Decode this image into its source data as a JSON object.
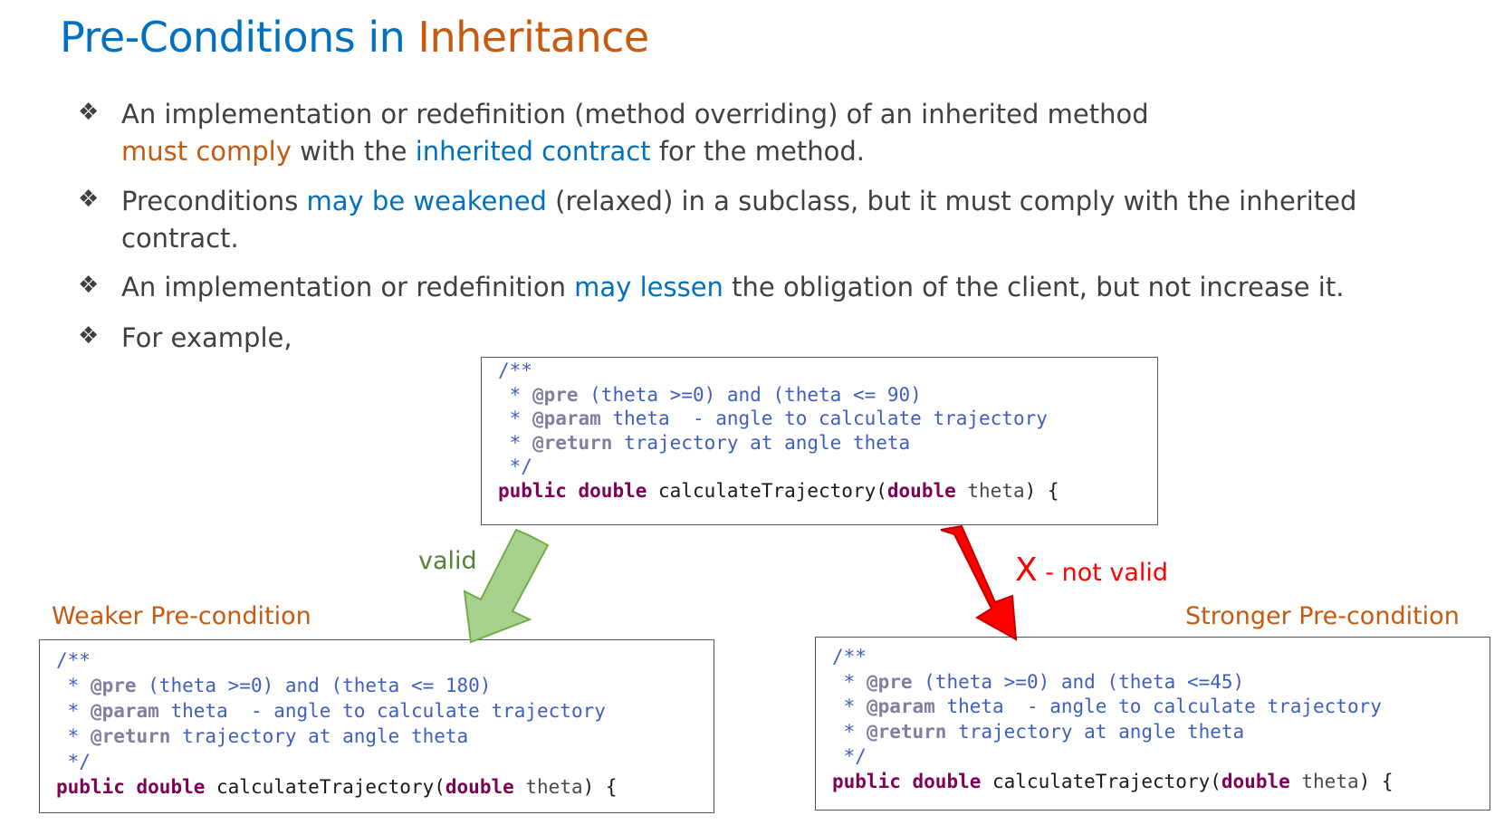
{
  "title": {
    "part1": "Pre-Conditions in ",
    "part2": "Inheritance"
  },
  "bullets": [
    {
      "mark": "❖",
      "segments": [
        {
          "text": "An implementation or redefinition (method overriding) of an inherited method",
          "color": "default"
        },
        {
          "text": "must comply",
          "color": "orange"
        },
        {
          "text": " with the ",
          "color": "default"
        },
        {
          "text": "inherited contract",
          "color": "blue"
        },
        {
          "text": " for the method.",
          "color": "default"
        }
      ]
    },
    {
      "mark": "❖",
      "segments": [
        {
          "text": "Preconditions ",
          "color": "default"
        },
        {
          "text": "may be weakened",
          "color": "blue"
        },
        {
          "text": " (relaxed) in a subclass, but it must comply with the inherited contract.",
          "color": "default"
        }
      ]
    },
    {
      "mark": "❖",
      "segments": [
        {
          "text": "An implementation or redefinition ",
          "color": "default"
        },
        {
          "text": "may lessen",
          "color": "blue"
        },
        {
          "text": " the obligation of the client, but not increase it.",
          "color": "default"
        }
      ]
    },
    {
      "mark": "❖",
      "segments": [
        {
          "text": "For example,",
          "color": "default"
        }
      ]
    }
  ],
  "code": {
    "base": {
      "open": "/**",
      "pre_tag": "@pre",
      "pre_text": " (theta >=0) and (theta <= 90)",
      "param_tag": "@param",
      "param_text": " theta  - angle to calculate trajectory",
      "return_tag": "@return",
      "return_text": " trajectory at angle theta",
      "close": " */",
      "kw_public": "public",
      "kw_double": "double",
      "method": " calculateTrajectory(",
      "kw_double2": "double",
      "arg": " theta",
      "end": ") {"
    },
    "weaker": {
      "open": "/**",
      "pre_tag": "@pre",
      "pre_text": " (theta >=0) and (theta <= 180)",
      "param_tag": "@param",
      "param_text": " theta  - angle to calculate trajectory",
      "return_tag": "@return",
      "return_text": " trajectory at angle theta",
      "close": " */",
      "kw_public": "public",
      "kw_double": "double",
      "method": " calculateTrajectory(",
      "kw_double2": "double",
      "arg": " theta",
      "end": ") {"
    },
    "stronger": {
      "open": "/**",
      "pre_tag": "@pre",
      "pre_text": " (theta >=0) and (theta <=45)",
      "param_tag": "@param",
      "param_text": " theta  - angle to calculate trajectory",
      "return_tag": "@return",
      "return_text": " trajectory at angle theta",
      "close": " */",
      "kw_public": "public",
      "kw_double": "double",
      "method": " calculateTrajectory(",
      "kw_double2": "double",
      "arg": " theta",
      "end": ") {"
    }
  },
  "labels": {
    "valid": "valid",
    "not_valid_x": "X",
    "not_valid_text": " - not valid",
    "weaker": "Weaker Pre-condition",
    "stronger": "Stronger Pre-condition"
  },
  "colors": {
    "blue": "#0070c0",
    "orange": "#c55a11",
    "valid_arrow": "#a9d18e",
    "invalid_arrow": "#ff0000"
  }
}
